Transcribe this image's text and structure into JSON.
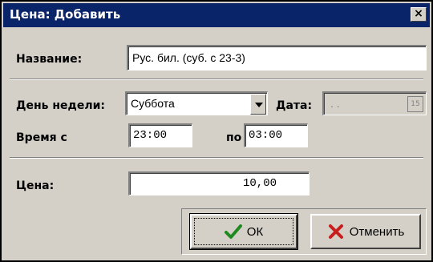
{
  "window": {
    "title": "Цена: Добавить",
    "close_glyph": "×"
  },
  "form": {
    "name_label": "Название:",
    "name_value": "Рус. бил. (суб. с 23-3)",
    "weekday_label": "День недели:",
    "weekday_value": "Суббота",
    "date_label": "Дата:",
    "date_value": ". .",
    "date_button_text": "15",
    "time_from_label": "Время с",
    "time_from_value": "23:00",
    "time_to_label": "по",
    "time_to_value": "03:00",
    "price_label": "Цена:",
    "price_value": "10,00"
  },
  "buttons": {
    "ok_label": "ОК",
    "cancel_label": "Отменить"
  },
  "icons": {
    "ok": "checkmark-icon",
    "cancel": "x-mark-icon",
    "calendar": "calendar-icon",
    "dropdown": "chevron-down-icon",
    "close": "close-icon"
  },
  "colors": {
    "titlebar": "#0a246a",
    "dialog_bg": "#d4d0c8",
    "check_green": "#1f8a1f",
    "cancel_red": "#c81e1e"
  }
}
